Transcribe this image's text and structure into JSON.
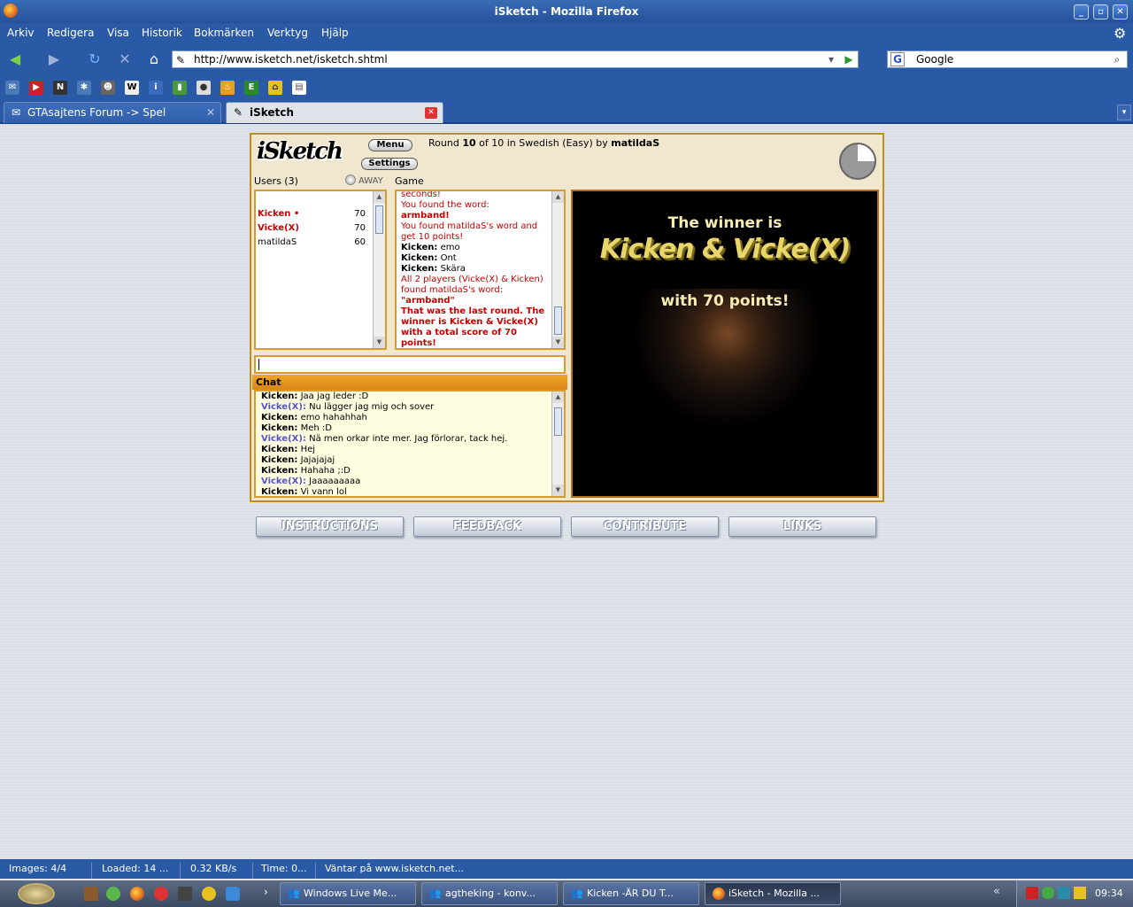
{
  "window": {
    "title": "iSketch - Mozilla Firefox"
  },
  "menu": [
    "Arkiv",
    "Redigera",
    "Visa",
    "Historik",
    "Bokmärken",
    "Verktyg",
    "Hjälp"
  ],
  "nav": {
    "url": "http://www.isketch.net/isketch.shtml",
    "search_placeholder": "Google"
  },
  "tabs": [
    {
      "label": "GTAsajtens Forum -> Spel",
      "active": false
    },
    {
      "label": "iSketch",
      "active": true
    }
  ],
  "game": {
    "menu_btn": "Menu",
    "settings_btn": "Settings",
    "round_prefix": "Round",
    "round_num": "10",
    "round_mid": "of 10 in Swedish (Easy) by",
    "drawer": "matildaS",
    "users_label": "Users (3)",
    "away_label": "AWAY",
    "game_label": "Game",
    "chat_label": "Chat",
    "users": [
      {
        "name": "Kicken •",
        "score": "70"
      },
      {
        "name": "Vicke(X)",
        "score": "70"
      },
      {
        "name": "matildaS",
        "score": "60"
      }
    ],
    "game_log": [
      {
        "text": "seconds!",
        "style": "red"
      },
      {
        "text": "You found the word:",
        "style": "red"
      },
      {
        "text": "armband!",
        "style": "redb"
      },
      {
        "text": "You found matildaS's word and get 10 points!",
        "style": "red"
      },
      {
        "who": "Kicken:",
        "text": "emo",
        "style": "plain"
      },
      {
        "who": "Kicken:",
        "text": "Ont",
        "style": "plain"
      },
      {
        "who": "Kicken:",
        "text": "Skära",
        "style": "plain"
      },
      {
        "text": "All 2 players (Vicke(X) & Kicken) found matildaS's word: ",
        "extra": "\"armband\"",
        "style": "red"
      },
      {
        "text": "That was the last round. The winner is Kicken & Vicke(X) with a total score of 70 points!",
        "style": "redb"
      }
    ],
    "chat": [
      {
        "who": "Kicken:",
        "text": "Jaa jag leder :D",
        "blue": false
      },
      {
        "who": "Vicke(X):",
        "text": "Nu lägger jag mig och sover",
        "blue": true
      },
      {
        "who": "Kicken:",
        "text": "emo hahahhah",
        "blue": false
      },
      {
        "who": "Kicken:",
        "text": "Meh :D",
        "blue": false
      },
      {
        "who": "Vicke(X):",
        "text": "Nä men orkar inte mer. Jag förlorar, tack hej.",
        "blue": true
      },
      {
        "who": "Kicken:",
        "text": "Hej",
        "blue": false
      },
      {
        "who": "Kicken:",
        "text": "Jajajajaj",
        "blue": false
      },
      {
        "who": "Kicken:",
        "text": "Hahaha ;:D",
        "blue": false
      },
      {
        "who": "Vicke(X):",
        "text": "Jaaaaaaaaa",
        "blue": true
      },
      {
        "who": "Kicken:",
        "text": "Vi vann lol",
        "blue": false
      }
    ],
    "winner_line1": "The winner is",
    "winner_line2": "Kicken & Vicke(X)",
    "winner_line3": "with 70 points!"
  },
  "buttons": [
    "INSTRUCTIONS",
    "FEEDBACK",
    "CONTRIBUTE",
    "LINKS"
  ],
  "status": {
    "images": "Images: 4/4",
    "loaded": "Loaded: 14 ...",
    "speed": "0.32 KB/s",
    "time": "Time: 0...",
    "message": "Väntar på www.isketch.net..."
  },
  "taskbar": {
    "tasks": [
      {
        "label": "Windows Live Me...",
        "active": false
      },
      {
        "label": "agtheking - konv...",
        "active": false
      },
      {
        "label": "Kicken -ÄR DU T...",
        "active": false
      },
      {
        "label": "iSketch - Mozilla ...",
        "active": true
      }
    ],
    "clock": "09:34"
  }
}
